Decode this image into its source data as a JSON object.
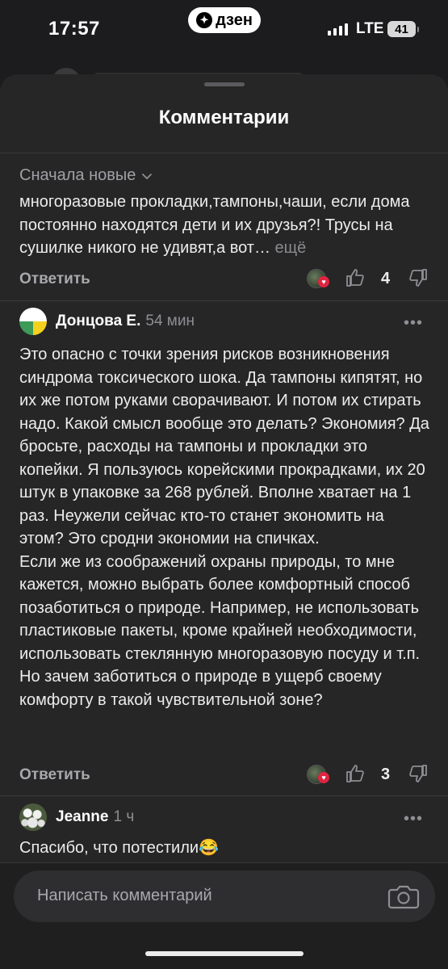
{
  "status": {
    "time": "17:57",
    "app_badge": "дзен",
    "network": "LTE",
    "battery": "41"
  },
  "sheet": {
    "title": "Комментарии",
    "sort_label": "Сначала новые"
  },
  "comments": [
    {
      "text": "многоразовые прокладки,тампоны,чаши, если дома постоянно находятся дети и их друзья?! Трусы на сушилке никого не удивят,а вот…",
      "more_label": "ещё",
      "reply_label": "Ответить",
      "likes": "4"
    },
    {
      "author": "Донцова Е.",
      "time": "54 мин",
      "text": "Это опасно с точки зрения рисков возникновения синдрома токсического шока. Да тампоны кипятят, но их же потом руками сворачивают. И потом их стирать надо. Какой смысл вообще это делать? Экономия? Да бросьте, расходы на тампоны и прокладки это копейки. Я пользуюсь корейскими прокрадками, их 20 штук в упаковке за 268 рублей. Вполне хватает на 1 раз. Неужели сейчас кто-то станет экономить на этом? Это сродни экономии на спичках.\nЕсли же из соображений охраны природы, то мне кажется, можно выбрать более комфортный способ позаботиться о природе. Например, не использовать пластиковые пакеты, кроме крайней необходимости, использовать стеклянную многоразовую посуду и т.п. Но зачем заботиться о природе в ущерб своему комфорту в такой чувствительной зоне?",
      "reply_label": "Ответить",
      "likes": "3"
    },
    {
      "author": "Jeanne",
      "time": "1 ч",
      "text": "Спасибо, что потестили😂"
    }
  ],
  "composer": {
    "placeholder": "Написать комментарий"
  },
  "icons": {
    "like": "thumbs-up-icon",
    "dislike": "thumbs-down-icon",
    "camera": "camera-icon",
    "more": "more-dots-icon",
    "sort": "chevron-down-icon",
    "reaction": "heart-icon"
  },
  "colors": {
    "background": "#1c1c1e",
    "sheet": "#262627",
    "heart": "#e0243f"
  }
}
